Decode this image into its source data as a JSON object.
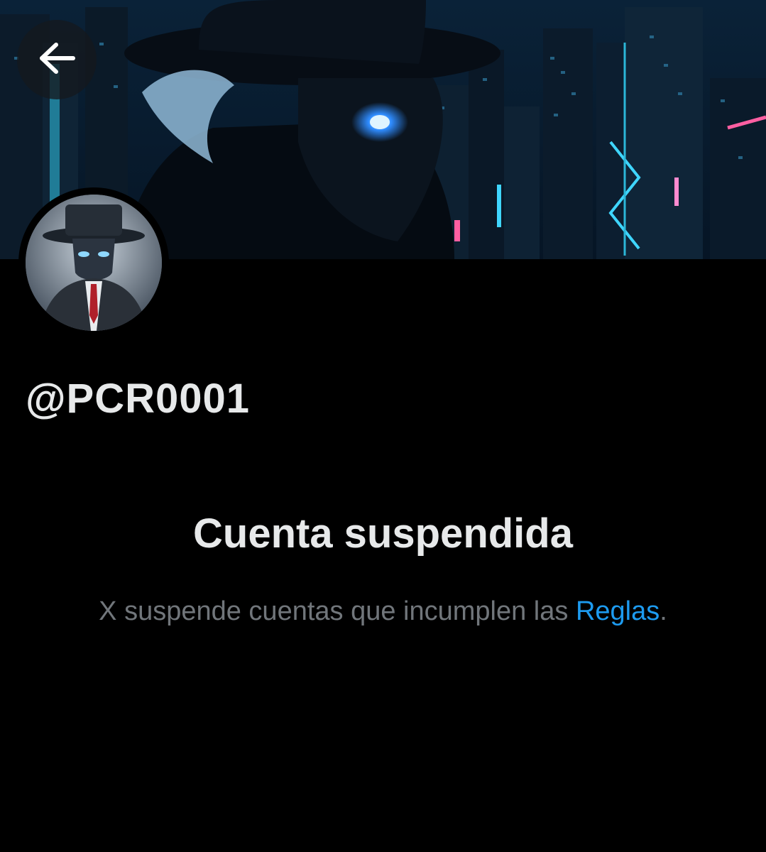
{
  "header": {
    "back_icon": "arrow-left-icon",
    "banner_description_icon": "cyberpunk-city-banner"
  },
  "profile": {
    "handle": "@PCR0001",
    "avatar_icon": "masked-figure-avatar"
  },
  "suspension": {
    "title": "Cuenta suspendida",
    "message_prefix": "X suspende cuentas que incumplen las ",
    "rules_link": "Reglas",
    "message_suffix": "."
  },
  "colors": {
    "background": "#000000",
    "primary_text": "#e7e9ea",
    "secondary_text": "#71767b",
    "link": "#1d9bf0"
  }
}
